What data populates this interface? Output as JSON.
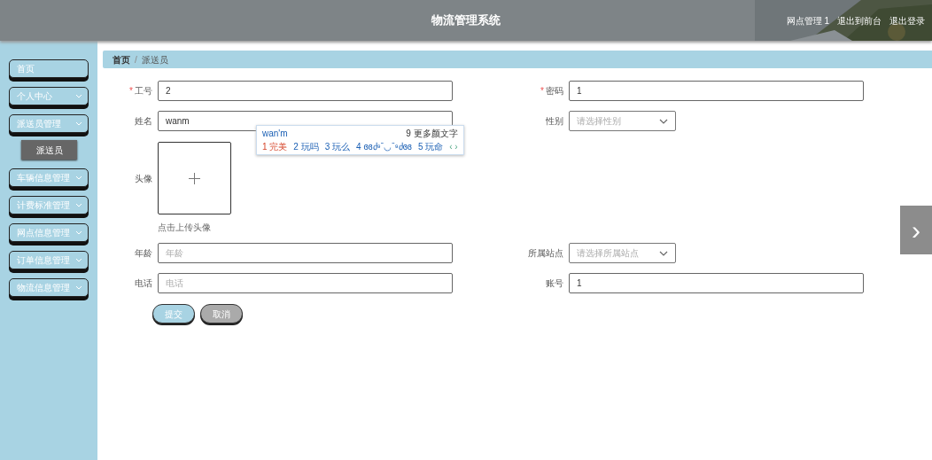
{
  "header": {
    "title": "物流管理系统",
    "links": [
      "网点管理 1",
      "退出到前台",
      "退出登录"
    ]
  },
  "sidebar": {
    "items": [
      {
        "label": "首页",
        "kind": "link"
      },
      {
        "label": "个人中心",
        "kind": "menu"
      },
      {
        "label": "派送员管理",
        "kind": "menu",
        "children": [
          {
            "label": "派送员",
            "selected": true
          }
        ]
      },
      {
        "label": "车辆信息管理",
        "kind": "menu"
      },
      {
        "label": "计费标准管理",
        "kind": "menu"
      },
      {
        "label": "网点信息管理",
        "kind": "menu"
      },
      {
        "label": "订单信息管理",
        "kind": "menu"
      },
      {
        "label": "物流信息管理",
        "kind": "menu"
      }
    ]
  },
  "breadcrumb": {
    "items": [
      "首页",
      "派送员"
    ],
    "separator": "/"
  },
  "form": {
    "row1": [
      {
        "kind": "input",
        "label": "工号",
        "required_mark": "*",
        "value": "2"
      },
      {
        "kind": "input",
        "label": "密码",
        "required_mark": "*",
        "value": "1"
      }
    ],
    "row2": [
      {
        "kind": "input",
        "label": "姓名",
        "value": "wanm"
      },
      {
        "kind": "select",
        "label": "性别",
        "placeholder": "请选择性别"
      }
    ],
    "avatar": {
      "label": "头像",
      "hint": "点击上传头像"
    },
    "row3": [
      {
        "kind": "input",
        "label": "年龄",
        "placeholder": "年龄"
      },
      {
        "kind": "select",
        "label": "所属站点",
        "placeholder": "请选择所属站点"
      }
    ],
    "row4": [
      {
        "kind": "input",
        "label": "电话",
        "placeholder": "电话"
      },
      {
        "kind": "input",
        "label": "账号",
        "value": "1"
      }
    ],
    "buttons": [
      {
        "label": "提交",
        "kind": "primary"
      },
      {
        "label": "取消",
        "kind": "secondary"
      }
    ]
  },
  "ime": {
    "composition": "wan'm",
    "more": "9 更多颜文字",
    "candidates": [
      {
        "index": "1",
        "text": "完美",
        "selected": true
      },
      {
        "index": "2",
        "text": "玩吗",
        "selected": false
      },
      {
        "index": "3",
        "text": "玩么",
        "selected": false
      },
      {
        "index": "4",
        "text": "ɞɞძ⁹ˉ◡ˉ⁹ძɞɞ",
        "selected": false
      },
      {
        "index": "5",
        "text": "玩命",
        "selected": false
      }
    ],
    "pager": "‹ ›"
  },
  "next_arrow": "›"
}
